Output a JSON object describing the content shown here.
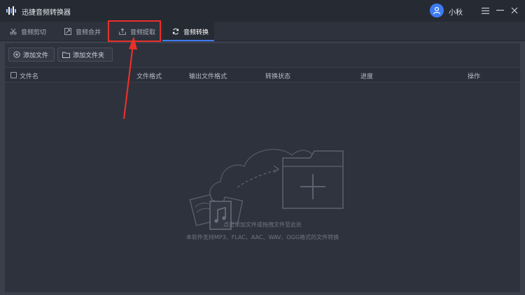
{
  "app": {
    "title": "迅捷音频转换器",
    "username": "小秋"
  },
  "tabs": [
    {
      "label": "音频剪切",
      "icon": "scissors-icon",
      "active": false
    },
    {
      "label": "音频合并",
      "icon": "merge-icon",
      "active": false
    },
    {
      "label": "音频提取",
      "icon": "extract-icon",
      "active": false,
      "highlighted": true
    },
    {
      "label": "音频转换",
      "icon": "convert-icon",
      "active": true
    }
  ],
  "toolbar": {
    "add_file_label": "添加文件",
    "add_folder_label": "添加文件夹"
  },
  "table": {
    "columns": [
      "文件名",
      "文件格式",
      "输出文件格式",
      "转换状态",
      "进度",
      "操作"
    ]
  },
  "dropzone": {
    "hint_primary": "点击添加文件或拖拽文件至此处",
    "hint_secondary": "本软件支持MP3、FLAC、AAC、WAV、OGG格式的文件转换"
  },
  "colors": {
    "accent": "#3d7bf2",
    "annotation": "#e8302a",
    "titlebar_bg": "#262a33",
    "panel_bg": "#2e323c"
  }
}
